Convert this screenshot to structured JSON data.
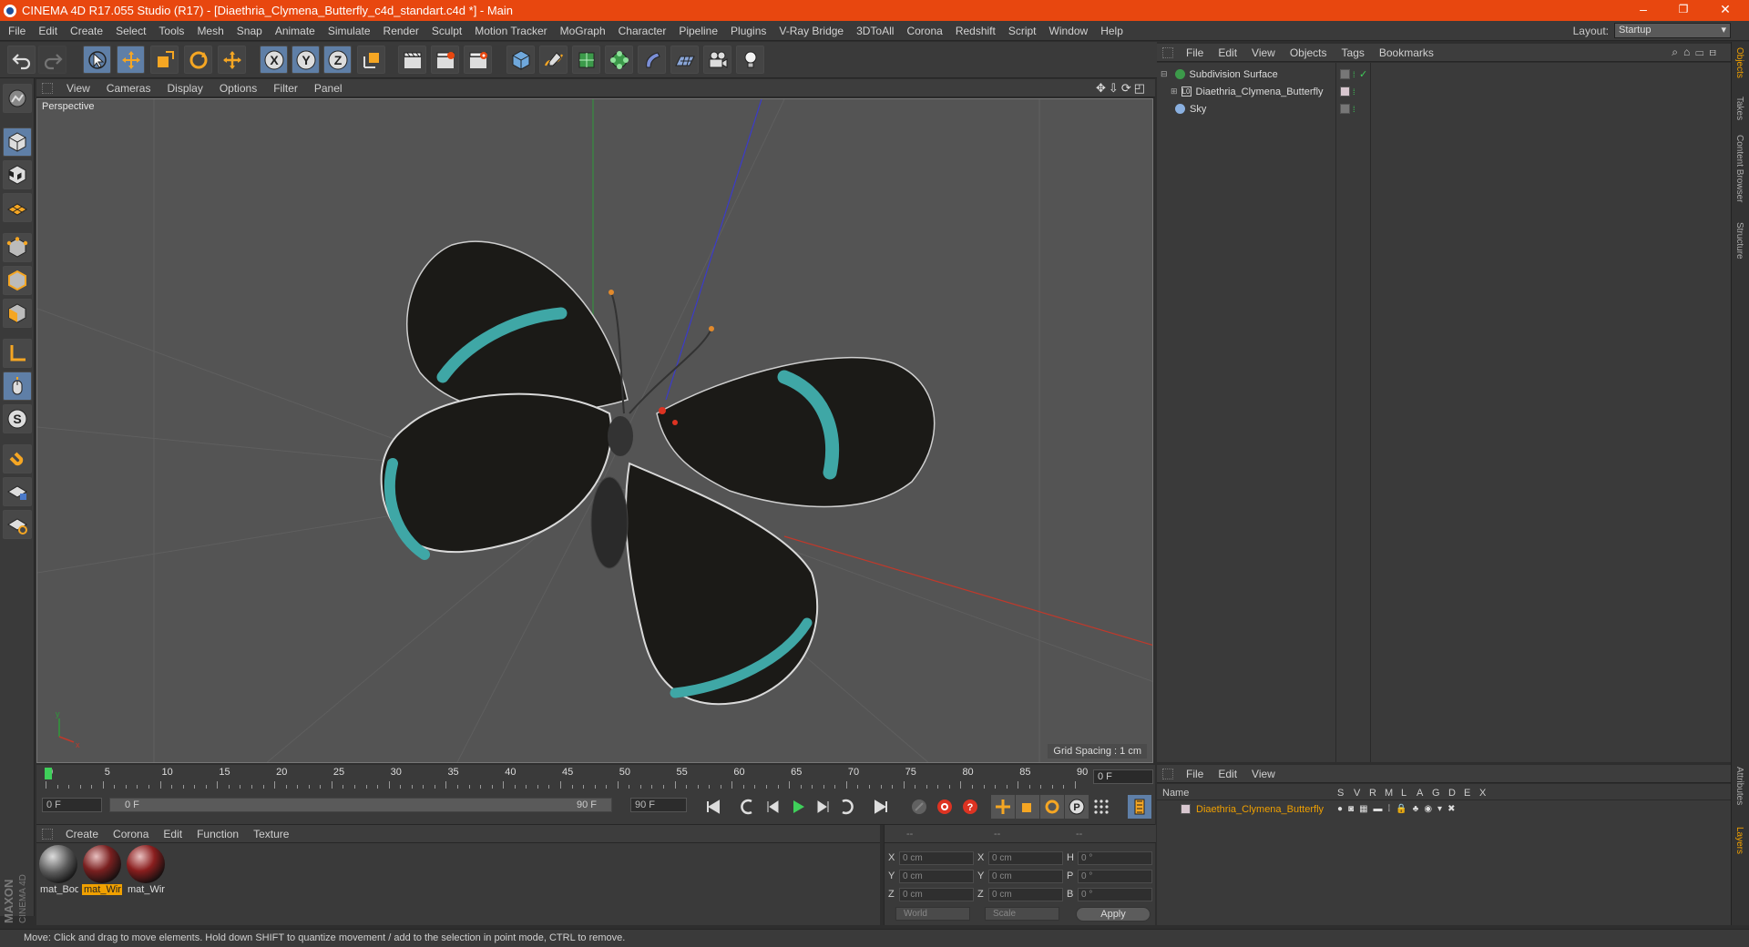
{
  "window": {
    "title": "CINEMA 4D R17.055 Studio (R17) - [Diaethria_Clymena_Butterfly_c4d_standart.c4d *] - Main",
    "controls": [
      "–",
      "❐",
      "✕"
    ]
  },
  "menubar": {
    "items": [
      "File",
      "Edit",
      "Create",
      "Select",
      "Tools",
      "Mesh",
      "Snap",
      "Animate",
      "Simulate",
      "Render",
      "Sculpt",
      "Motion Tracker",
      "MoGraph",
      "Character",
      "Pipeline",
      "Plugins",
      "V-Ray Bridge",
      "3DToAll",
      "Corona",
      "Redshift",
      "Script",
      "Window",
      "Help"
    ],
    "layout_label": "Layout:",
    "layout_value": "Startup"
  },
  "viewport": {
    "menu": [
      "View",
      "Cameras",
      "Display",
      "Options",
      "Filter",
      "Panel"
    ],
    "label": "Perspective",
    "grid_spacing": "Grid Spacing : 1 cm",
    "axis_labels": [
      "y",
      "x"
    ]
  },
  "timeline": {
    "ticks": [
      "0",
      "5",
      "10",
      "15",
      "20",
      "25",
      "30",
      "35",
      "40",
      "45",
      "50",
      "55",
      "60",
      "65",
      "70",
      "75",
      "80",
      "85",
      "90"
    ],
    "current_frame": "0 F"
  },
  "transport": {
    "start": "0 F",
    "range_start": "0 F",
    "range_end": "90 F",
    "end": "90 F"
  },
  "materials": {
    "menu": [
      "Create",
      "Corona",
      "Edit",
      "Function",
      "Texture"
    ],
    "items": [
      {
        "label": "mat_Bod",
        "selected": false
      },
      {
        "label": "mat_Wir",
        "selected": true
      },
      {
        "label": "mat_Wir",
        "selected": false
      }
    ]
  },
  "coords": {
    "header": [
      "--",
      "--",
      "--"
    ],
    "rows": [
      {
        "a": "X",
        "av": "0 cm",
        "b": "X",
        "bv": "0 cm",
        "c": "H",
        "cv": "0 °"
      },
      {
        "a": "Y",
        "av": "0 cm",
        "b": "Y",
        "bv": "0 cm",
        "c": "P",
        "cv": "0 °"
      },
      {
        "a": "Z",
        "av": "0 cm",
        "b": "Z",
        "bv": "0 cm",
        "c": "B",
        "cv": "0 °"
      }
    ],
    "world": "World",
    "scale": "Scale",
    "apply": "Apply"
  },
  "objects": {
    "menu": [
      "File",
      "Edit",
      "View",
      "Objects",
      "Tags",
      "Bookmarks"
    ],
    "rows": [
      "Subdivision Surface",
      "Diaethria_Clymena_Butterfly",
      "Sky"
    ]
  },
  "layers": {
    "menu": [
      "File",
      "Edit",
      "View"
    ],
    "columns": [
      "Name",
      "S",
      "V",
      "R",
      "M",
      "L",
      "A",
      "G",
      "D",
      "E",
      "X"
    ],
    "row": "Diaethria_Clymena_Butterfly"
  },
  "sidetabs": [
    "Objects",
    "Takes",
    "Content Browser",
    "Structure",
    "Attributes",
    "Layers"
  ],
  "status": "Move: Click and drag to move elements. Hold down SHIFT to quantize movement / add to the selection in point mode, CTRL to remove.",
  "brand": {
    "line1": "MAXON",
    "line2": "CINEMA 4D"
  },
  "colors": {
    "title_bar": "#e8470f",
    "active_tool": "#5f7fa7",
    "selected_text": "#f0a000",
    "x_axis": "#c0392b",
    "y_axis": "#2e9a3a",
    "z_axis": "#3b3bc9"
  }
}
